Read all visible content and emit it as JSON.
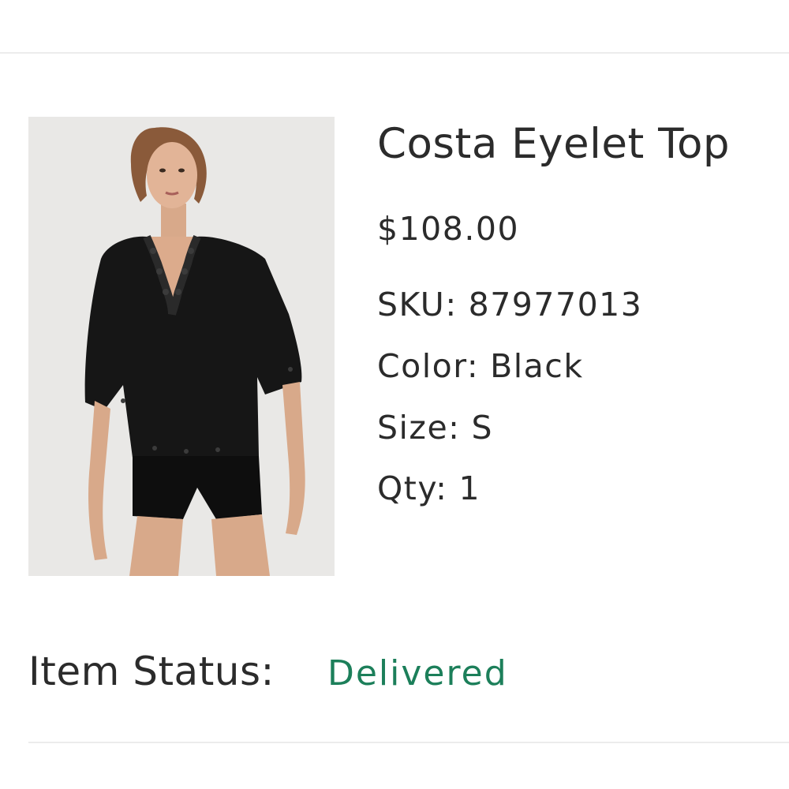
{
  "product": {
    "title": "Costa Eyelet Top",
    "price": "$108.00",
    "image_alt": "Model wearing black eyelet top with black shorts"
  },
  "attributes": {
    "sku_label": "SKU:",
    "sku_value": "87977013",
    "color_label": "Color:",
    "color_value": "Black",
    "size_label": "Size:",
    "size_value": "S",
    "qty_label": "Qty:",
    "qty_value": "1"
  },
  "status": {
    "label": "Item Status:",
    "value": "Delivered",
    "value_color": "#1c7f5a"
  },
  "colors": {
    "text": "#2b2b2b",
    "divider": "#ececec",
    "image_bg": "#e9e8e6"
  }
}
